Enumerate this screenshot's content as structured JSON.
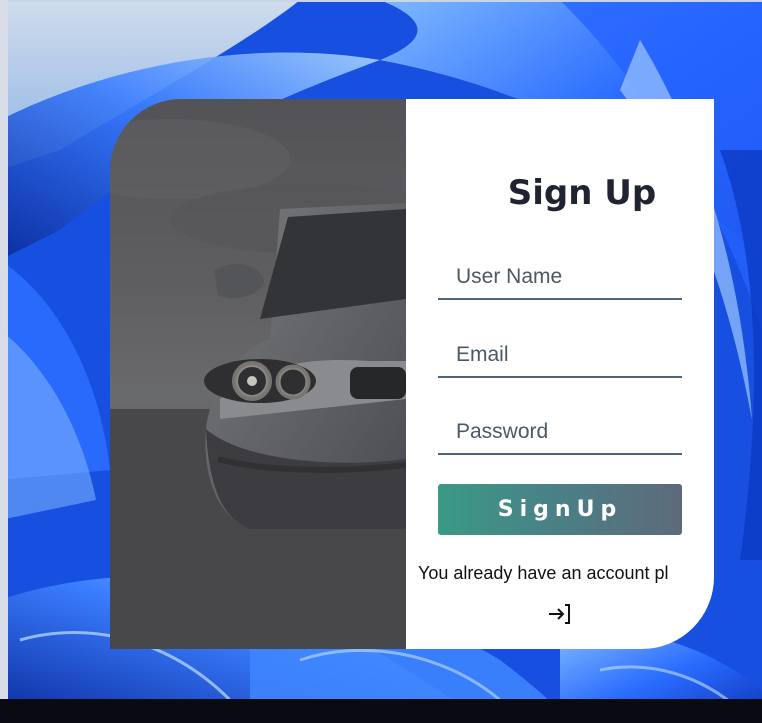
{
  "signup": {
    "title": "Sign Up",
    "username": {
      "placeholder": "User Name",
      "value": ""
    },
    "email": {
      "placeholder": "Email",
      "value": ""
    },
    "password": {
      "placeholder": "Password",
      "value": ""
    },
    "submit_label": "SignUp",
    "already_text": "You already have an account pl",
    "login_icon": "login-arrow-icon"
  },
  "colors": {
    "panel_bg": "#ffffff",
    "title": "#1f2430",
    "field_underline": "#4f6477",
    "button_gradient_start": "#3a9a86",
    "button_gradient_end": "#5d6a7a",
    "photo_bg": "#4e4e50",
    "wallpaper": "#1b56e6"
  }
}
